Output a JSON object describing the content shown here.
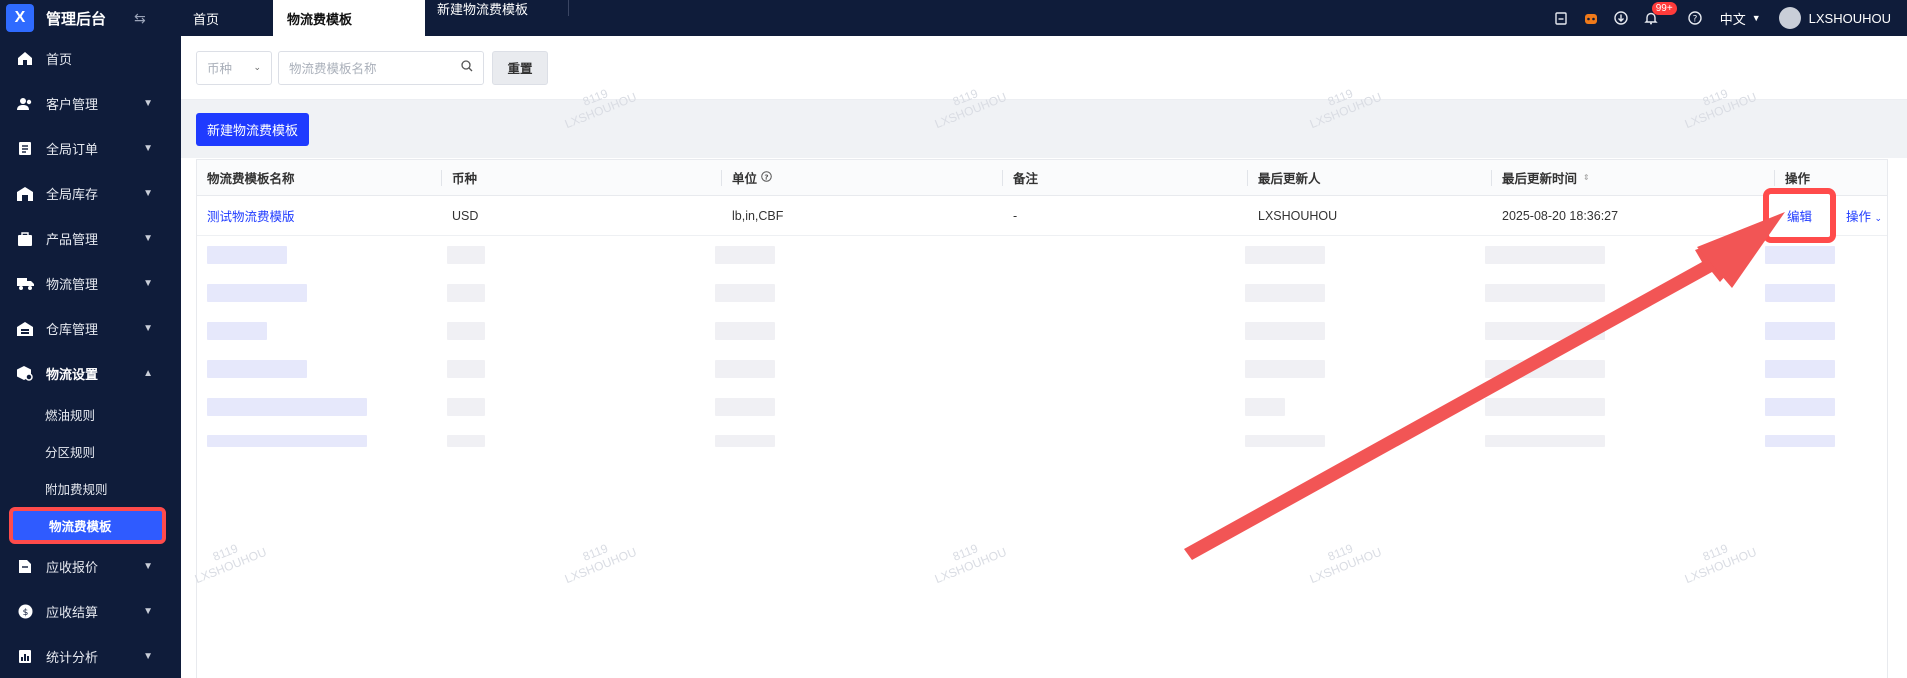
{
  "app": {
    "logo_mark": "X",
    "title": "管理后台"
  },
  "tabs": [
    {
      "label": "首页"
    },
    {
      "label": "物流费模板"
    },
    {
      "label": "新建物流费模板"
    }
  ],
  "topbar": {
    "notification_count": "99+",
    "language": "中文",
    "username": "LXSHOUHOU"
  },
  "sidebar": {
    "items": [
      {
        "label": "首页",
        "icon": "home-icon"
      },
      {
        "label": "客户管理",
        "icon": "users-icon"
      },
      {
        "label": "全局订单",
        "icon": "order-icon"
      },
      {
        "label": "全局库存",
        "icon": "warehouse-icon"
      },
      {
        "label": "产品管理",
        "icon": "product-icon"
      },
      {
        "label": "物流管理",
        "icon": "truck-icon"
      },
      {
        "label": "仓库管理",
        "icon": "storehouse-icon"
      },
      {
        "label": "物流设置",
        "icon": "package-settings-icon"
      },
      {
        "label": "应收报价",
        "icon": "quote-icon"
      },
      {
        "label": "应收结算",
        "icon": "settlement-icon"
      },
      {
        "label": "统计分析",
        "icon": "stats-icon"
      }
    ],
    "sub_items": [
      {
        "label": "燃油规则"
      },
      {
        "label": "分区规则"
      },
      {
        "label": "附加费规则"
      },
      {
        "label": "物流费模板"
      }
    ]
  },
  "filters": {
    "currency_placeholder": "币种",
    "search_placeholder": "物流费模板名称",
    "reset_label": "重置"
  },
  "actions": {
    "new_label": "新建物流费模板"
  },
  "table": {
    "columns": [
      "物流费模板名称",
      "币种",
      "单位",
      "备注",
      "最后更新人",
      "最后更新时间",
      "操作"
    ],
    "rows": [
      {
        "name": "测试物流费模版",
        "currency": "USD",
        "unit": "lb,in,CBF",
        "remark": "-",
        "updated_by": "LXSHOUHOU",
        "updated_at": "2025-08-20 18:36:27",
        "edit": "编辑",
        "more": "操作"
      }
    ]
  },
  "watermark": {
    "line1": "8119",
    "line2": "LXSHOUHOU"
  },
  "colors": {
    "sidebar_bg": "#0f1c3a",
    "primary": "#1f3bff",
    "highlight": "#ff4b4b"
  }
}
